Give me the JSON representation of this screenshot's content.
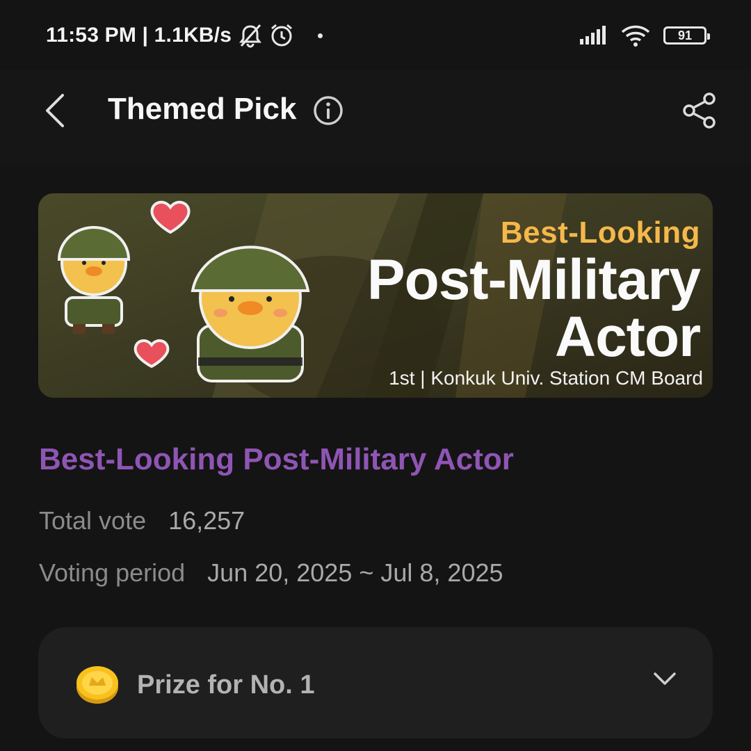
{
  "status_bar": {
    "time_speed": "11:53 PM | 1.1KB/s",
    "battery": "91"
  },
  "header": {
    "title": "Themed Pick"
  },
  "banner": {
    "subtitle": "Best-Looking",
    "title_line1": "Post-Military",
    "title_line2": "Actor",
    "footer": "1st | Konkuk Univ. Station CM Board"
  },
  "vote": {
    "title": "Best-Looking Post-Military Actor",
    "total_label": "Total vote",
    "total_value": "16,257",
    "period_label": "Voting period",
    "period_value": "Jun 20, 2025 ~ Jul 8, 2025"
  },
  "prize": {
    "label": "Prize for No. 1"
  },
  "icons": {
    "status": [
      "bell-off-icon",
      "alarm-icon",
      "signal-icon",
      "wifi-icon",
      "battery-icon"
    ],
    "header": [
      "back-icon",
      "info-icon",
      "share-icon"
    ],
    "prize": [
      "coin-icon",
      "chevron-down-icon"
    ]
  },
  "colors": {
    "background": "#141414",
    "accent_purple": "#8f55b5",
    "banner_highlight": "#f5b84a",
    "card": "#1f1f1f"
  }
}
